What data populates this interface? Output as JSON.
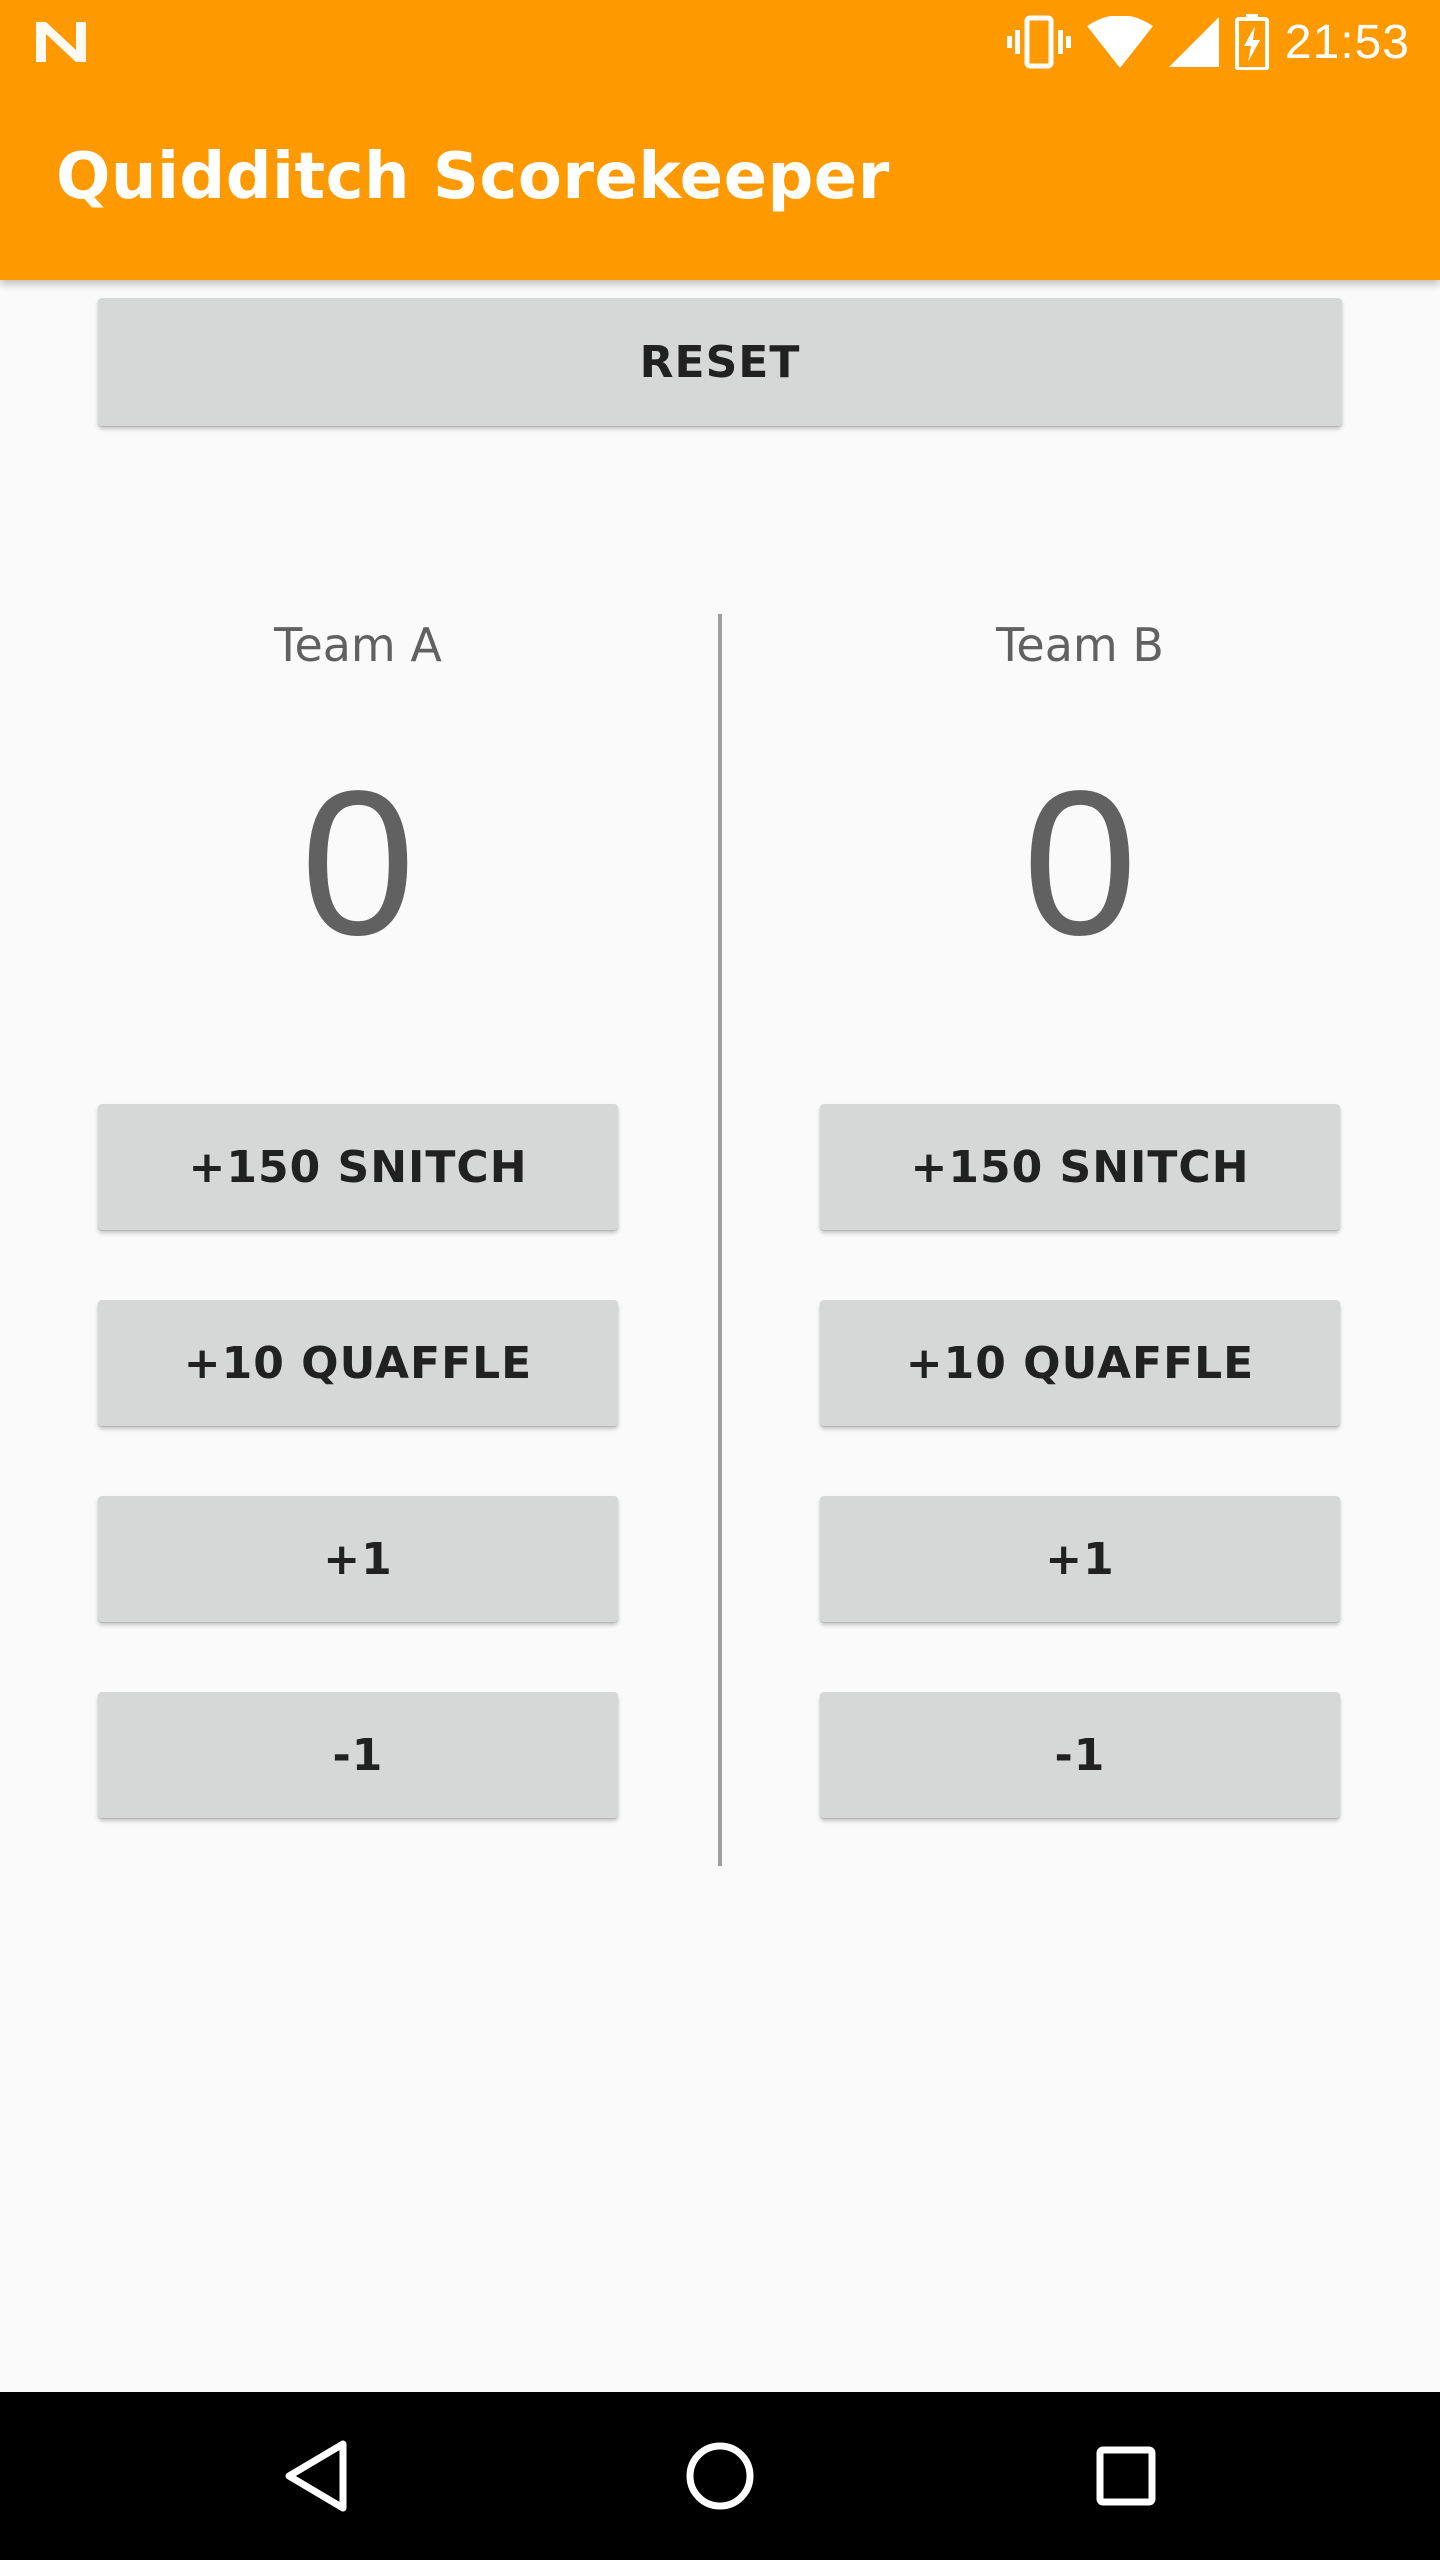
{
  "status_bar": {
    "time": "21:53",
    "icons": [
      "notification-n-icon",
      "vibrate-icon",
      "wifi-icon",
      "signal-icon",
      "battery-charging-icon"
    ]
  },
  "app_bar": {
    "title": "Quidditch Scorekeeper"
  },
  "reset_label": "RESET",
  "team_a": {
    "name": "Team A",
    "score": "0",
    "buttons": [
      "+150 SNITCH",
      "+10 QUAFFLE",
      "+1",
      "-1"
    ]
  },
  "team_b": {
    "name": "Team B",
    "score": "0",
    "buttons": [
      "+150 SNITCH",
      "+10 QUAFFLE",
      "+1",
      "-1"
    ]
  },
  "nav_bar": {
    "icons": [
      "back-icon",
      "home-icon",
      "recent-apps-icon"
    ]
  },
  "colors": {
    "accent": "#ff9900",
    "button": "#d6d7d7",
    "background": "#fafafa"
  }
}
